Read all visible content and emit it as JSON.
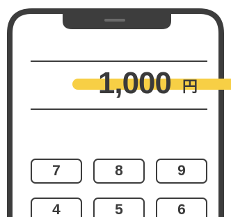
{
  "display": {
    "amount": "1,000",
    "currency": "円"
  },
  "keypad": {
    "rows": [
      [
        "7",
        "8",
        "9"
      ],
      [
        "4",
        "5",
        "6"
      ]
    ]
  },
  "colors": {
    "outline": "#3d3d3d",
    "highlight": "#f7cf45",
    "text": "#3a3a3a"
  }
}
